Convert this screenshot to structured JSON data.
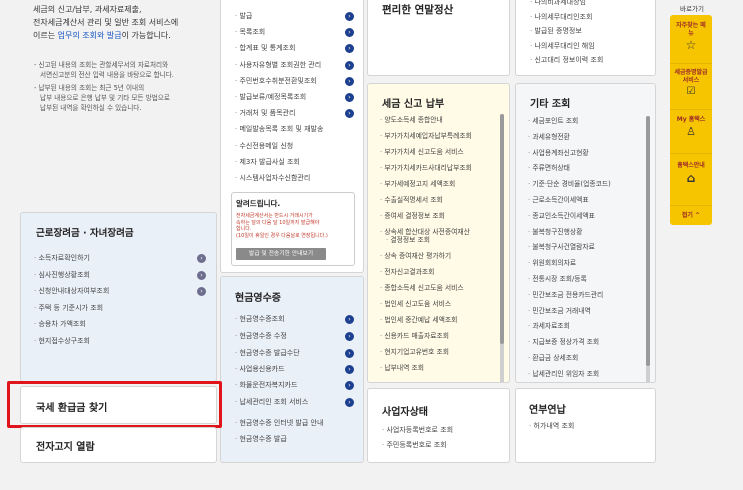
{
  "left_intro": {
    "line1": "세금의 신고/납부, 과세자료제출,",
    "line2": "전자세금계산서 관리 및 일반 조회 서비스에",
    "line3_prefix": "이르는 ",
    "line3_link": "업무의 조회와 발급",
    "line3_suffix": "이 가능합니다.",
    "note1_line1": "- 신고된 내용의 조회는 관할세무서의 자료처리와",
    "note1_line2": "서면신고분의 전산 입력 내용을 바탕으로 합니다.",
    "note2_line1": "- 납부된 내용의 조회는 최근 5년 이내의",
    "note2_line2": "납부 내용으로 은행 납부 및 기타 모든 방법으로",
    "note2_line3": "납부된 내역을 확인하실 수 있습니다."
  },
  "issue_col": {
    "items": [
      {
        "label": "발급"
      },
      {
        "label": "목록조회"
      },
      {
        "label": "합계표 및 통계조회"
      },
      {
        "label": "사용자유형별 조회권한 관리"
      },
      {
        "label": "주민번호수취분전환및조회"
      },
      {
        "label": "발급보류/예정목록조회"
      },
      {
        "label": "거래처 및 품목관리"
      },
      {
        "label": "메일발송목록 조회 및 재발송"
      },
      {
        "label": "수신전용메일 신청"
      },
      {
        "label": "제3자 발급사실 조회"
      },
      {
        "label": "시스템사업자수신함관리"
      }
    ],
    "notice_title": "알려드립니다.",
    "notice_line1": "전자세금계산서는 반드시 거래시기가",
    "notice_line2": "속하는 달의 다음 달 10일까지 발급해야",
    "notice_line3": "합니다.",
    "notice_line4": "(10일이 휴일인 경우 다음날로 연장됩니다.)",
    "notice_button": "발급 및 전송기한 안내보기"
  },
  "year_end": {
    "title": "편리한 연말정산"
  },
  "other_top": {
    "items": [
      "나의비과세대상임",
      "나의세무대리인조회",
      "발급된 증명정보",
      "나의세무대리인 해임",
      "신고대리 정보이력 조회"
    ]
  },
  "tax_report": {
    "title": "세금 신고 납부",
    "items": [
      "양도소득세 종합안내",
      "부가가치세예입자납부특례조회",
      "부가가치세 신고도움 서비스",
      "부가가치세카드사대리납부조회",
      "부가세예정고지 세액조회",
      "수출실적명세서 조회",
      "증여세 결정정보 조회",
      "상속세 합산대상 사전증여재산",
      "결정정보 조회",
      "상속 증여재산 평가하기",
      "전자신고결과조회",
      "종합소득세 신고도움 서비스",
      "법인세 신고도움 서비스",
      "법인세 중간예납 세액조회",
      "신용카드 매출자료조회",
      "현지기업고유번호 조회",
      "납부내역 조회"
    ]
  },
  "other_inquiry": {
    "title": "기타 조회",
    "items": [
      "세금포인트 조회",
      "과세유형전환",
      "사업용계좌신고현황",
      "주류면허상태",
      "기준·단순 경비율(업종코드)",
      "근로소득간이세액표",
      "종교인소득간이세액표",
      "불복청구진행상황",
      "불복청구사건열람자료",
      "위원회회의자료",
      "전통시장 조회/등록",
      "민간보조금 전용카드관리",
      "민간보조금 거래내역",
      "과세자료조회",
      "지급보증 정상가격 조회",
      "환급금 상세조회",
      "납세관리인 위임자 조회"
    ]
  },
  "labor": {
    "title": "근로장려금 · 자녀장려금",
    "items": [
      {
        "label": "소득자료확인하기",
        "has_btn": true
      },
      {
        "label": "심사진행상황조회",
        "has_btn": true
      },
      {
        "label": "신청안내대상자여부조회",
        "has_btn": true
      },
      {
        "label": "주택 등 기준시가 조회",
        "has_btn": false
      },
      {
        "label": "승용차 가액조회",
        "has_btn": false
      },
      {
        "label": "현지접수상구조회",
        "has_btn": false
      }
    ]
  },
  "cash_receipt": {
    "title": "현금영수증",
    "items": [
      {
        "label": "현금영수증조회",
        "has_btn": true
      },
      {
        "label": "현금영수증 수정",
        "has_btn": true
      },
      {
        "label": "현금영수증 발급수단",
        "has_btn": true
      },
      {
        "label": "사업용신용카드",
        "has_btn": true
      },
      {
        "label": "화물운전자복지카드",
        "has_btn": true
      },
      {
        "label": "납세관리인 조회 서비스",
        "has_btn": true
      },
      {
        "label": "현금영수증 인터넷 발급 안내",
        "has_btn": false
      },
      {
        "label": "현금영수증 발급",
        "has_btn": false
      }
    ]
  },
  "refund": {
    "title": "국세 환급금 찾기"
  },
  "e_notice": {
    "title": "전자고지 열람"
  },
  "business_status": {
    "title": "사업자상태",
    "items": [
      "사업자등록번호로 조회",
      "주민등록번호로 조회"
    ]
  },
  "pension": {
    "title": "연부연납",
    "items": [
      "허가내역 조회"
    ]
  },
  "quick": {
    "title": "바로가기",
    "faq": "자주찾는 메뉴",
    "refund_service": "세금증명발급 서비스",
    "my_page": "My 홈택스",
    "hometax_guide": "홈택스안내",
    "collapse": "접기"
  },
  "colors": {
    "highlight_red": "#e0141b",
    "link_blue": "#1a56c4",
    "icon_navy": "#1d3f8f",
    "side_yellow": "#f7c400"
  }
}
